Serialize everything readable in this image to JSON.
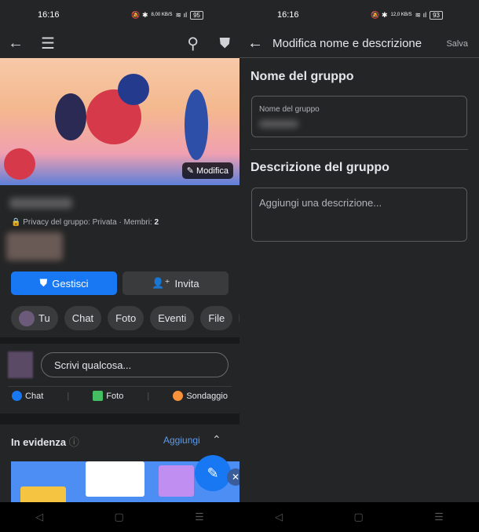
{
  "status": {
    "time": "16:16",
    "battery_left": "95",
    "battery_right": "93",
    "speed_left": "8,00 KB/S",
    "speed_right": "12,0 KB/S"
  },
  "left": {
    "cover": {
      "edit_label": "Modifica"
    },
    "privacy": {
      "text": "Privacy del gruppo: Privata · Membri: ",
      "members": "2"
    },
    "buttons": {
      "manage": "Gestisci",
      "invite": "Invita"
    },
    "chips": [
      "Tu",
      "Chat",
      "Foto",
      "Eventi",
      "File",
      "F"
    ],
    "composer": {
      "placeholder": "Scrivi qualcosa..."
    },
    "actions": [
      {
        "label": "Chat",
        "color": "#1877f2"
      },
      {
        "label": "Foto",
        "color": "#45bd62"
      },
      {
        "label": "Sondaggio",
        "color": "#f7923b"
      }
    ],
    "featured": {
      "title": "In evidenza",
      "add": "Aggiungi"
    }
  },
  "right": {
    "header": {
      "title": "Modifica nome e descrizione",
      "save": "Salva"
    },
    "name_section": "Nome del gruppo",
    "name_field_label": "Nome del gruppo",
    "desc_section": "Descrizione del gruppo",
    "desc_placeholder": "Aggiungi una descrizione..."
  },
  "colors": {
    "accent": "#1877f2",
    "bg": "#242526",
    "chip": "#3a3b3c"
  }
}
